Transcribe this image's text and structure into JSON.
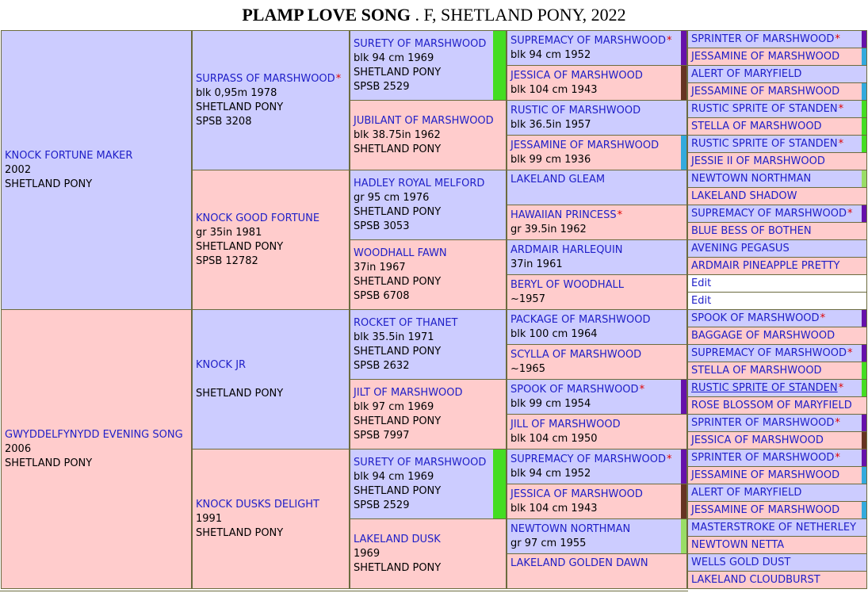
{
  "title": {
    "name": "PLAMP LOVE SONG",
    "details": ". F, SHETLAND PONY, 2022"
  },
  "colors": {
    "male": "#ccccff",
    "female": "#ffcccc",
    "name": "#2020c8",
    "star": "#e00000",
    "border": "#6b6b3e",
    "bar_green": "#44dd22",
    "bar_purple": "#6611aa",
    "bar_brown": "#663322",
    "bar_blue": "#33aadd",
    "bar_lightgreen": "#99dd66"
  },
  "pedigree": {
    "g1": [
      {
        "name": "KNOCK FORTUNE MAKER",
        "lines": [
          "2002",
          "SHETLAND PONY"
        ],
        "sex": "m"
      },
      {
        "name": "GWYDDELFYNYDD EVENING SONG",
        "lines": [
          "2006",
          "SHETLAND PONY"
        ],
        "sex": "f"
      }
    ],
    "g2": [
      {
        "name": "SURPASS OF MARSHWOOD",
        "star": true,
        "lines": [
          "blk 0,95m 1978",
          "SHETLAND PONY",
          "SPSB 3208"
        ],
        "sex": "m"
      },
      {
        "name": "KNOCK GOOD FORTUNE",
        "lines": [
          "gr 35in 1981",
          "SHETLAND PONY",
          "SPSB 12782"
        ],
        "sex": "f"
      },
      {
        "name": "KNOCK JR",
        "lines": [
          "",
          "SHETLAND PONY"
        ],
        "sex": "m"
      },
      {
        "name": "KNOCK DUSKS DELIGHT",
        "lines": [
          "1991",
          "SHETLAND PONY"
        ],
        "sex": "f"
      }
    ],
    "g3": [
      {
        "name": "SURETY OF MARSHWOOD",
        "lines": [
          "blk 94 cm 1969",
          "SHETLAND PONY",
          "SPSB 2529"
        ],
        "sex": "m",
        "bar": "green"
      },
      {
        "name": "JUBILANT OF MARSHWOOD",
        "lines": [
          "blk 38.75in 1962",
          "SHETLAND PONY"
        ],
        "sex": "f"
      },
      {
        "name": "HADLEY ROYAL MELFORD",
        "lines": [
          "gr 95 cm 1976",
          "SHETLAND PONY",
          "SPSB 3053"
        ],
        "sex": "m"
      },
      {
        "name": "WOODHALL FAWN",
        "lines": [
          "37in 1967",
          "SHETLAND PONY",
          "SPSB 6708"
        ],
        "sex": "f"
      },
      {
        "name": "ROCKET OF THANET",
        "lines": [
          "blk 35.5in 1971",
          "SHETLAND PONY",
          "SPSB 2632"
        ],
        "sex": "m"
      },
      {
        "name": "JILT OF MARSHWOOD",
        "lines": [
          "blk 97 cm 1969",
          "SHETLAND PONY",
          "SPSB 7997"
        ],
        "sex": "f"
      },
      {
        "name": "SURETY OF MARSHWOOD",
        "lines": [
          "blk 94 cm 1969",
          "SHETLAND PONY",
          "SPSB 2529"
        ],
        "sex": "m",
        "bar": "green"
      },
      {
        "name": "LAKELAND DUSK",
        "lines": [
          "1969",
          "SHETLAND PONY"
        ],
        "sex": "f"
      }
    ],
    "g4": [
      {
        "name": "SUPREMACY OF MARSHWOOD",
        "star": true,
        "lines": [
          "blk 94 cm 1952"
        ],
        "sex": "m",
        "bar": "purple"
      },
      {
        "name": "JESSICA OF MARSHWOOD",
        "lines": [
          "blk 104 cm 1943"
        ],
        "sex": "f",
        "bar": "brown"
      },
      {
        "name": "RUSTIC OF MARSHWOOD",
        "lines": [
          "blk 36.5in 1957"
        ],
        "sex": "m"
      },
      {
        "name": "JESSAMINE OF MARSHWOOD",
        "lines": [
          "blk 99 cm 1936"
        ],
        "sex": "f",
        "bar": "blue"
      },
      {
        "name": "LAKELAND GLEAM",
        "lines": [],
        "sex": "m"
      },
      {
        "name": "HAWAIIAN PRINCESS",
        "star": true,
        "lines": [
          "gr 39.5in 1962"
        ],
        "sex": "f"
      },
      {
        "name": "ARDMAIR HARLEQUIN",
        "lines": [
          "37in 1961"
        ],
        "sex": "m"
      },
      {
        "name": "BERYL OF WOODHALL",
        "lines": [
          "~1957"
        ],
        "sex": "f"
      },
      {
        "name": "PACKAGE OF MARSHWOOD",
        "lines": [
          "blk 100 cm 1964"
        ],
        "sex": "m"
      },
      {
        "name": "SCYLLA OF MARSHWOOD",
        "lines": [
          "~1965"
        ],
        "sex": "f"
      },
      {
        "name": "SPOOK OF MARSHWOOD",
        "star": true,
        "lines": [
          "blk 99 cm 1954"
        ],
        "sex": "m",
        "bar": "purple"
      },
      {
        "name": "JILL OF MARSHWOOD",
        "lines": [
          "blk 104 cm 1950"
        ],
        "sex": "f"
      },
      {
        "name": "SUPREMACY OF MARSHWOOD",
        "star": true,
        "lines": [
          "blk 94 cm 1952"
        ],
        "sex": "m",
        "bar": "purple"
      },
      {
        "name": "JESSICA OF MARSHWOOD",
        "lines": [
          "blk 104 cm 1943"
        ],
        "sex": "f",
        "bar": "brown"
      },
      {
        "name": "NEWTOWN NORTHMAN",
        "lines": [
          "gr 97 cm 1955"
        ],
        "sex": "m",
        "bar": "lightgreen"
      },
      {
        "name": "LAKELAND GOLDEN DAWN",
        "lines": [],
        "sex": "f"
      }
    ],
    "g5": [
      {
        "name": "SPRINTER OF MARSHWOOD",
        "star": true,
        "sex": "m",
        "bar": "purple"
      },
      {
        "name": "JESSAMINE OF MARSHWOOD",
        "sex": "f",
        "bar": "blue"
      },
      {
        "name": "ALERT OF MARYFIELD",
        "sex": "m"
      },
      {
        "name": "JESSAMINE OF MARSHWOOD",
        "sex": "f",
        "bar": "blue"
      },
      {
        "name": "RUSTIC SPRITE OF STANDEN",
        "star": true,
        "sex": "m",
        "bar": "green"
      },
      {
        "name": "STELLA OF MARSHWOOD",
        "sex": "f",
        "bar": "green"
      },
      {
        "name": "RUSTIC SPRITE OF STANDEN",
        "star": true,
        "sex": "m",
        "bar": "green"
      },
      {
        "name": "JESSIE II OF MARSHWOOD",
        "sex": "f"
      },
      {
        "name": "NEWTOWN NORTHMAN",
        "sex": "m",
        "bar": "lightgreen"
      },
      {
        "name": "LAKELAND SHADOW",
        "sex": "f"
      },
      {
        "name": "SUPREMACY OF MARSHWOOD",
        "star": true,
        "sex": "m",
        "bar": "purple"
      },
      {
        "name": "BLUE BESS OF BOTHEN",
        "sex": "f"
      },
      {
        "name": "AVENING PEGASUS",
        "sex": "m"
      },
      {
        "name": "ARDMAIR PINEAPPLE PRETTY",
        "sex": "f"
      },
      {
        "name": "Edit",
        "sex": "e",
        "edit": true
      },
      {
        "name": "Edit",
        "sex": "e",
        "edit": true
      },
      {
        "name": "SPOOK OF MARSHWOOD",
        "star": true,
        "sex": "m",
        "bar": "purple"
      },
      {
        "name": "BAGGAGE OF MARSHWOOD",
        "sex": "f"
      },
      {
        "name": "SUPREMACY OF MARSHWOOD",
        "star": true,
        "sex": "m",
        "bar": "purple"
      },
      {
        "name": "STELLA OF MARSHWOOD",
        "sex": "f",
        "bar": "green"
      },
      {
        "name": "RUSTIC SPRITE OF STANDEN",
        "star": true,
        "sex": "m",
        "bar": "green",
        "link": true
      },
      {
        "name": "ROSE BLOSSOM OF MARYFIELD",
        "sex": "f"
      },
      {
        "name": "SPRINTER OF MARSHWOOD",
        "star": true,
        "sex": "m",
        "bar": "purple"
      },
      {
        "name": "JESSICA OF MARSHWOOD",
        "sex": "f",
        "bar": "brown"
      },
      {
        "name": "SPRINTER OF MARSHWOOD",
        "star": true,
        "sex": "m",
        "bar": "purple"
      },
      {
        "name": "JESSAMINE OF MARSHWOOD",
        "sex": "f",
        "bar": "blue"
      },
      {
        "name": "ALERT OF MARYFIELD",
        "sex": "m"
      },
      {
        "name": "JESSAMINE OF MARSHWOOD",
        "sex": "f",
        "bar": "blue"
      },
      {
        "name": "MASTERSTROKE OF NETHERLEY",
        "sex": "m"
      },
      {
        "name": "NEWTOWN NETTA",
        "sex": "f"
      },
      {
        "name": "WELLS GOLD DUST",
        "sex": "m"
      },
      {
        "name": "LAKELAND CLOUDBURST",
        "sex": "f"
      }
    ]
  }
}
